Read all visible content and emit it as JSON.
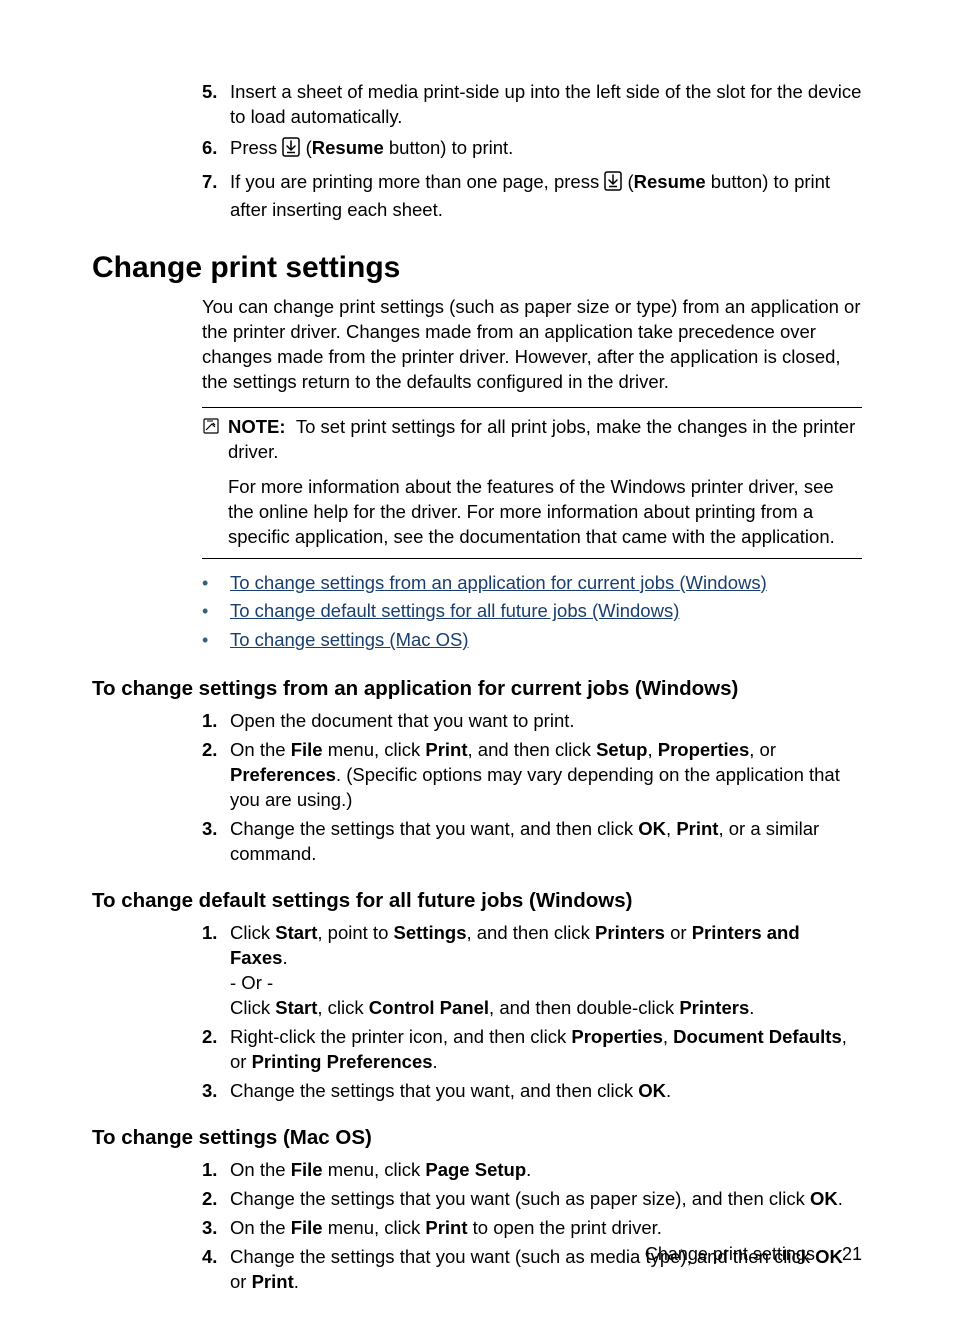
{
  "top_list": [
    {
      "num": "5.",
      "html": "Insert a sheet of media print-side up into the left side of the slot for the device to load automatically."
    },
    {
      "num": "6.",
      "html": "Press {ICON} (<b>Resume</b> button) to print."
    },
    {
      "num": "7.",
      "html": "If you are printing more than one page, press {ICON} (<b>Resume</b> button) to print after inserting each sheet."
    }
  ],
  "h1": "Change print settings",
  "intro": "You can change print settings (such as paper size or type) from an application or the printer driver. Changes made from an application take precedence over changes made from the printer driver. However, after the application is closed, the settings return to the defaults configured in the driver.",
  "note": {
    "label": "NOTE:",
    "line1": "To set print settings for all print jobs, make the changes in the printer driver.",
    "line2": "For more information about the features of the Windows printer driver, see the online help for the driver. For more information about printing from a specific application, see the documentation that came with the application."
  },
  "links": [
    "To change settings from an application for current jobs (Windows)",
    "To change default settings for all future jobs (Windows)",
    "To change settings (Mac OS)"
  ],
  "sections": [
    {
      "heading": "To change settings from an application for current jobs (Windows)",
      "steps": [
        {
          "num": "1.",
          "html": "Open the document that you want to print."
        },
        {
          "num": "2.",
          "html": "On the <b>File</b> menu, click <b>Print</b>, and then click <b>Setup</b>, <b>Properties</b>, or <b>Preferences</b>. (Specific options may vary depending on the application that you are using.)"
        },
        {
          "num": "3.",
          "html": "Change the settings that you want, and then click <b>OK</b>, <b>Print</b>, or a similar command."
        }
      ]
    },
    {
      "heading": "To change default settings for all future jobs (Windows)",
      "steps": [
        {
          "num": "1.",
          "html": "Click <b>Start</b>, point to <b>Settings</b>, and then click <b>Printers</b> or <b>Printers and Faxes</b>.<br>- Or -<br>Click <b>Start</b>, click <b>Control Panel</b>, and then double-click <b>Printers</b>."
        },
        {
          "num": "2.",
          "html": "Right-click the printer icon, and then click <b>Properties</b>, <b>Document Defaults</b>, or <b>Printing Preferences</b>."
        },
        {
          "num": "3.",
          "html": "Change the settings that you want, and then click <b>OK</b>."
        }
      ]
    },
    {
      "heading": "To change settings (Mac OS)",
      "steps": [
        {
          "num": "1.",
          "html": "On the <b>File</b> menu, click <b>Page Setup</b>."
        },
        {
          "num": "2.",
          "html": "Change the settings that you want (such as paper size), and then click <b>OK</b>."
        },
        {
          "num": "3.",
          "html": "On the <b>File</b> menu, click <b>Print</b> to open the print driver."
        },
        {
          "num": "4.",
          "html": "Change the settings that you want (such as media type), and then click <b>OK</b> or <b>Print</b>."
        }
      ]
    }
  ],
  "footer": {
    "title": "Change print settings",
    "page": "21"
  }
}
